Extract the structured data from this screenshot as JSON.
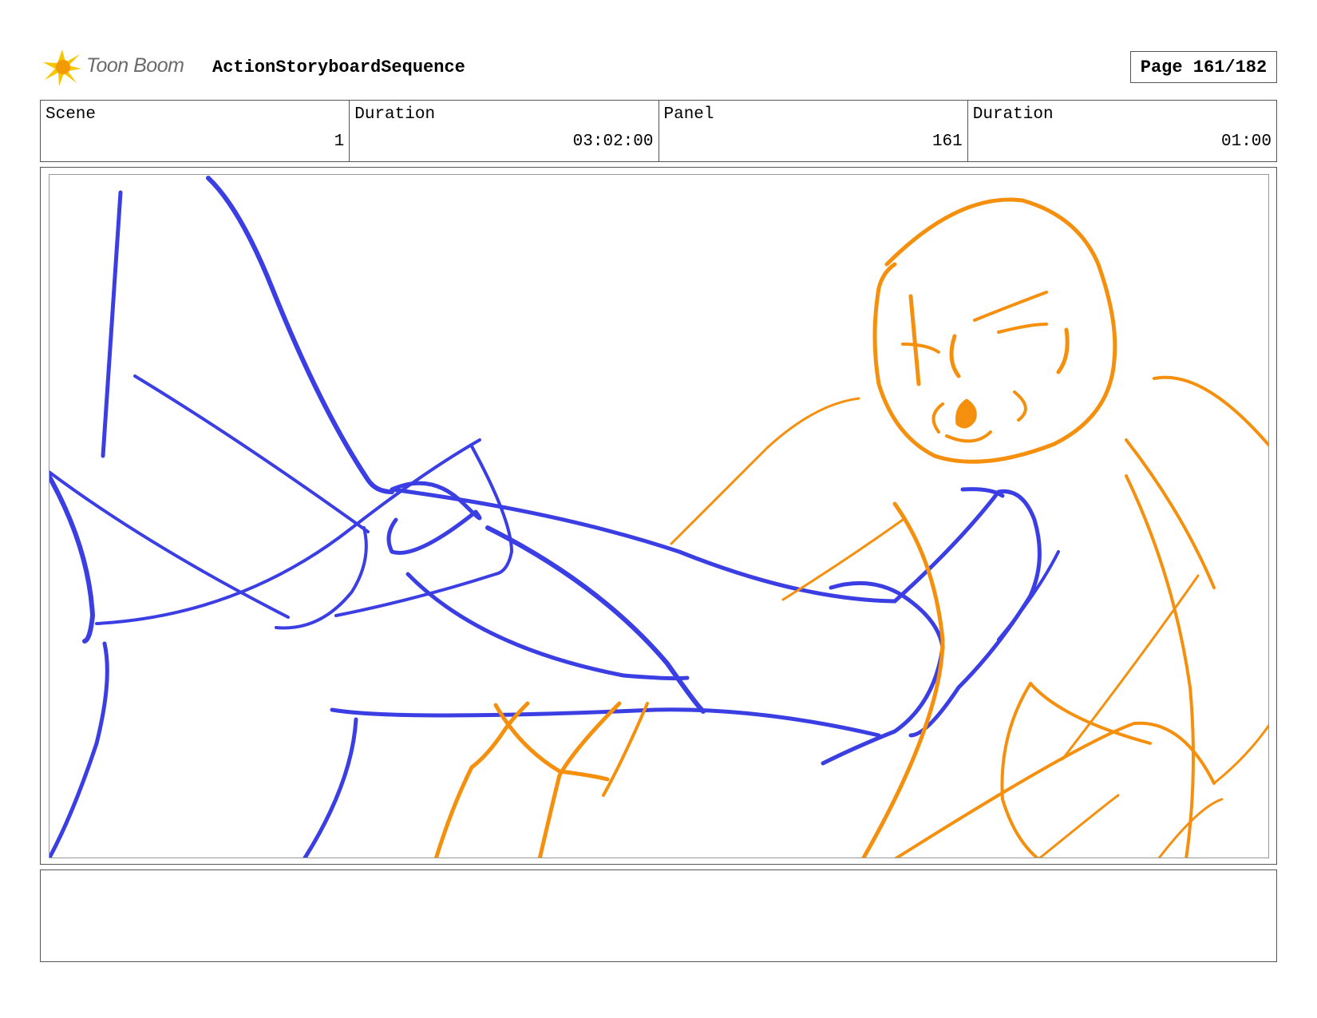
{
  "header": {
    "logo_text": "Toon Boom",
    "project_title": "ActionStoryboardSequence",
    "page_label": "Page 161/182"
  },
  "info": {
    "scene_label": "Scene",
    "scene_value": "1",
    "scene_duration_label": "Duration",
    "scene_duration_value": "03:02:00",
    "panel_label": "Panel",
    "panel_value": "161",
    "panel_duration_label": "Duration",
    "panel_duration_value": "01:00"
  },
  "sketch": {
    "colors": {
      "blue": "#3b3ee3",
      "orange": "#f5900f"
    },
    "content": "rough storyboard sketch: blue foreground figure kicking, orange character being hit"
  },
  "notes": {
    "text": ""
  }
}
